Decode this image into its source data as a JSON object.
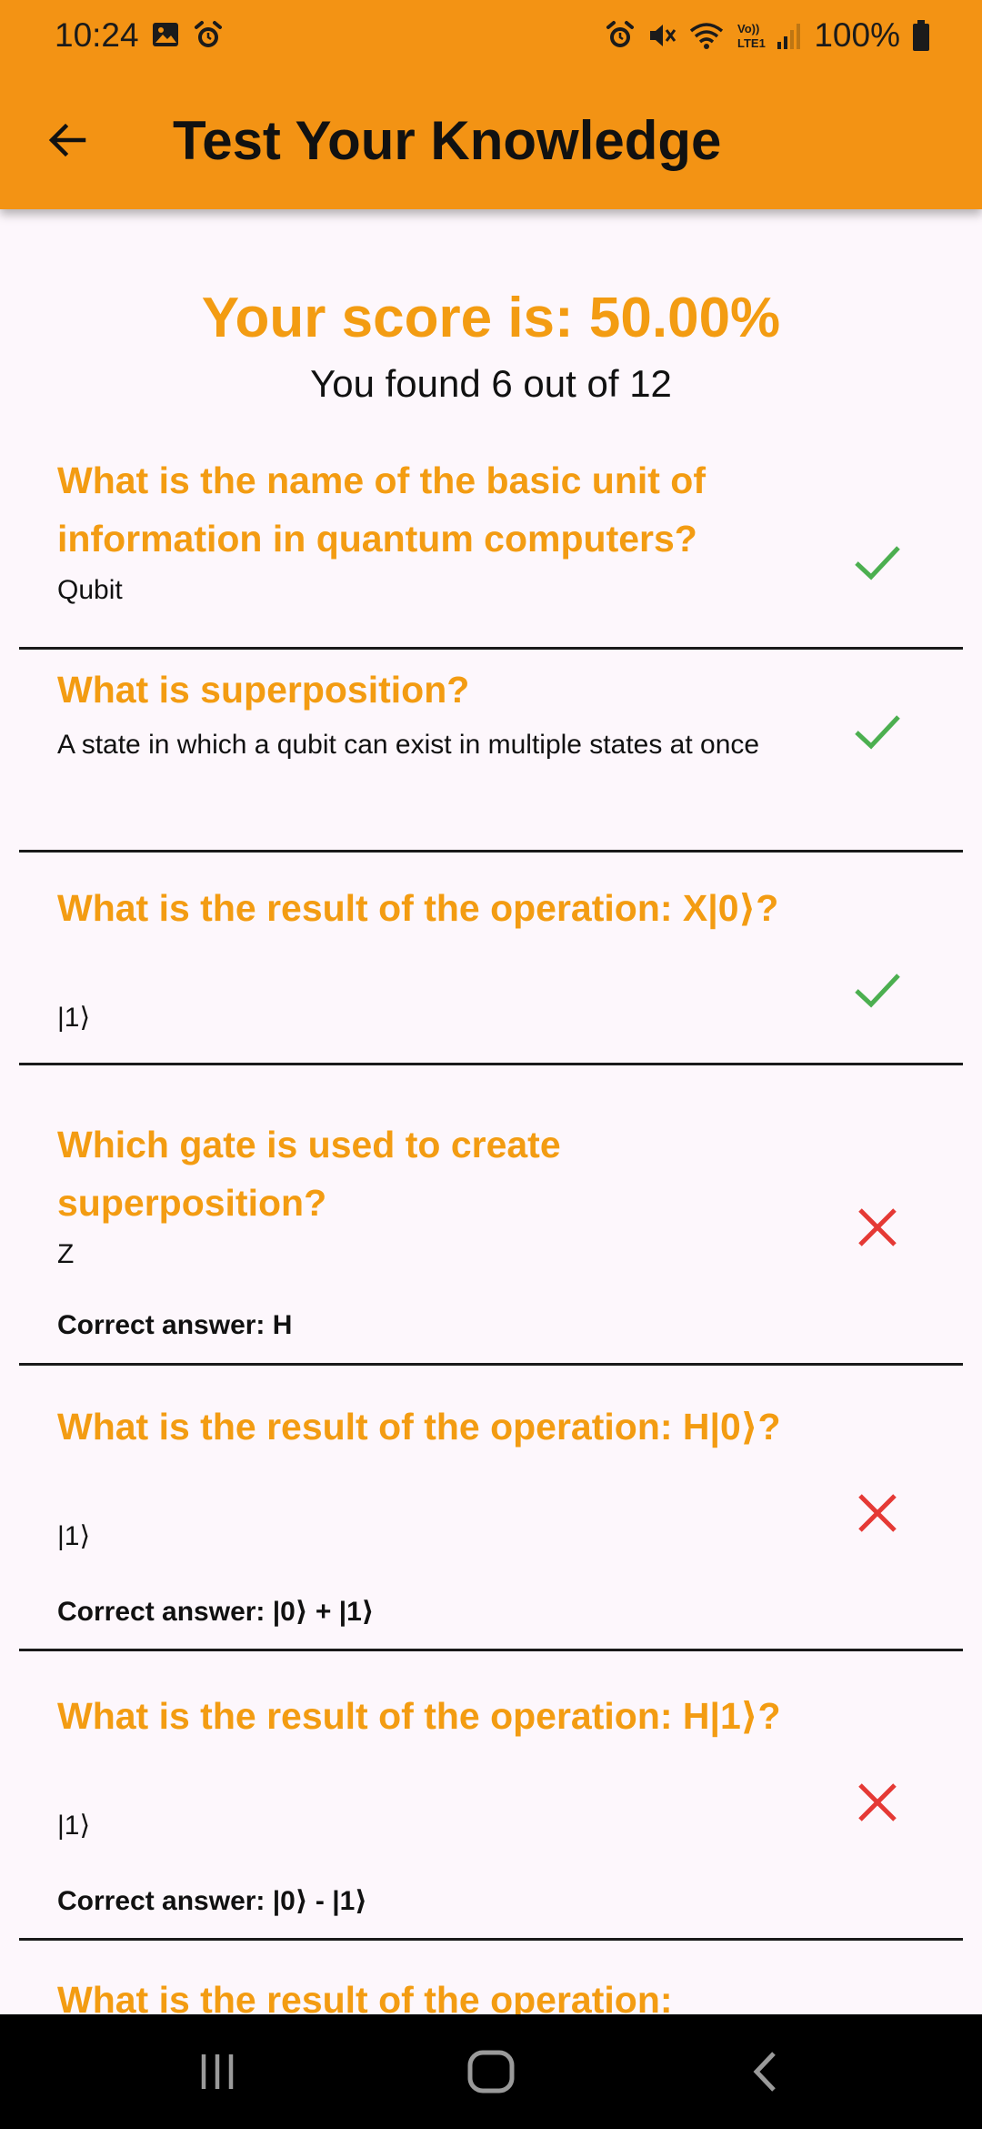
{
  "status_bar": {
    "time": "10:24",
    "battery": "100%",
    "network_label": "Vo)) LTE1"
  },
  "app_bar": {
    "title": "Test Your Knowledge",
    "back_icon": "arrow-left-icon"
  },
  "result": {
    "score_text": "Your score is: 50.00%",
    "found_text": "You found 6 out of 12"
  },
  "items": [
    {
      "question": "What is the name of the basic unit of information in quantum computers?",
      "answer": "Qubit",
      "correct": true
    },
    {
      "question": "What is superposition?",
      "answer": "A state in which a qubit can exist in multiple states at once",
      "correct": true
    },
    {
      "question": "What is the result of the operation: X|0⟩?",
      "answer": "|1⟩",
      "correct": true
    },
    {
      "question": "Which gate is used to create superposition?",
      "answer": "Z",
      "correct": false,
      "correct_answer": "Correct answer: H"
    },
    {
      "question": "What is the result of the operation: H|0⟩?",
      "answer": "|1⟩",
      "correct": false,
      "correct_answer": "Correct answer: |0⟩ + |1⟩"
    },
    {
      "question": "What is the result of the operation: H|1⟩?",
      "answer": "|1⟩",
      "correct": false,
      "correct_answer": "Correct answer: |0⟩ - |1⟩"
    },
    {
      "question": "What is the result of the operation:",
      "answer": "",
      "correct": false
    }
  ],
  "colors": {
    "accent": "#f39314",
    "question": "#f39c12",
    "check": "#4caf50",
    "cross": "#e53935"
  },
  "nav": {
    "recents_icon": "recents-icon",
    "home_icon": "home-icon",
    "back_icon": "back-chevron-icon"
  }
}
